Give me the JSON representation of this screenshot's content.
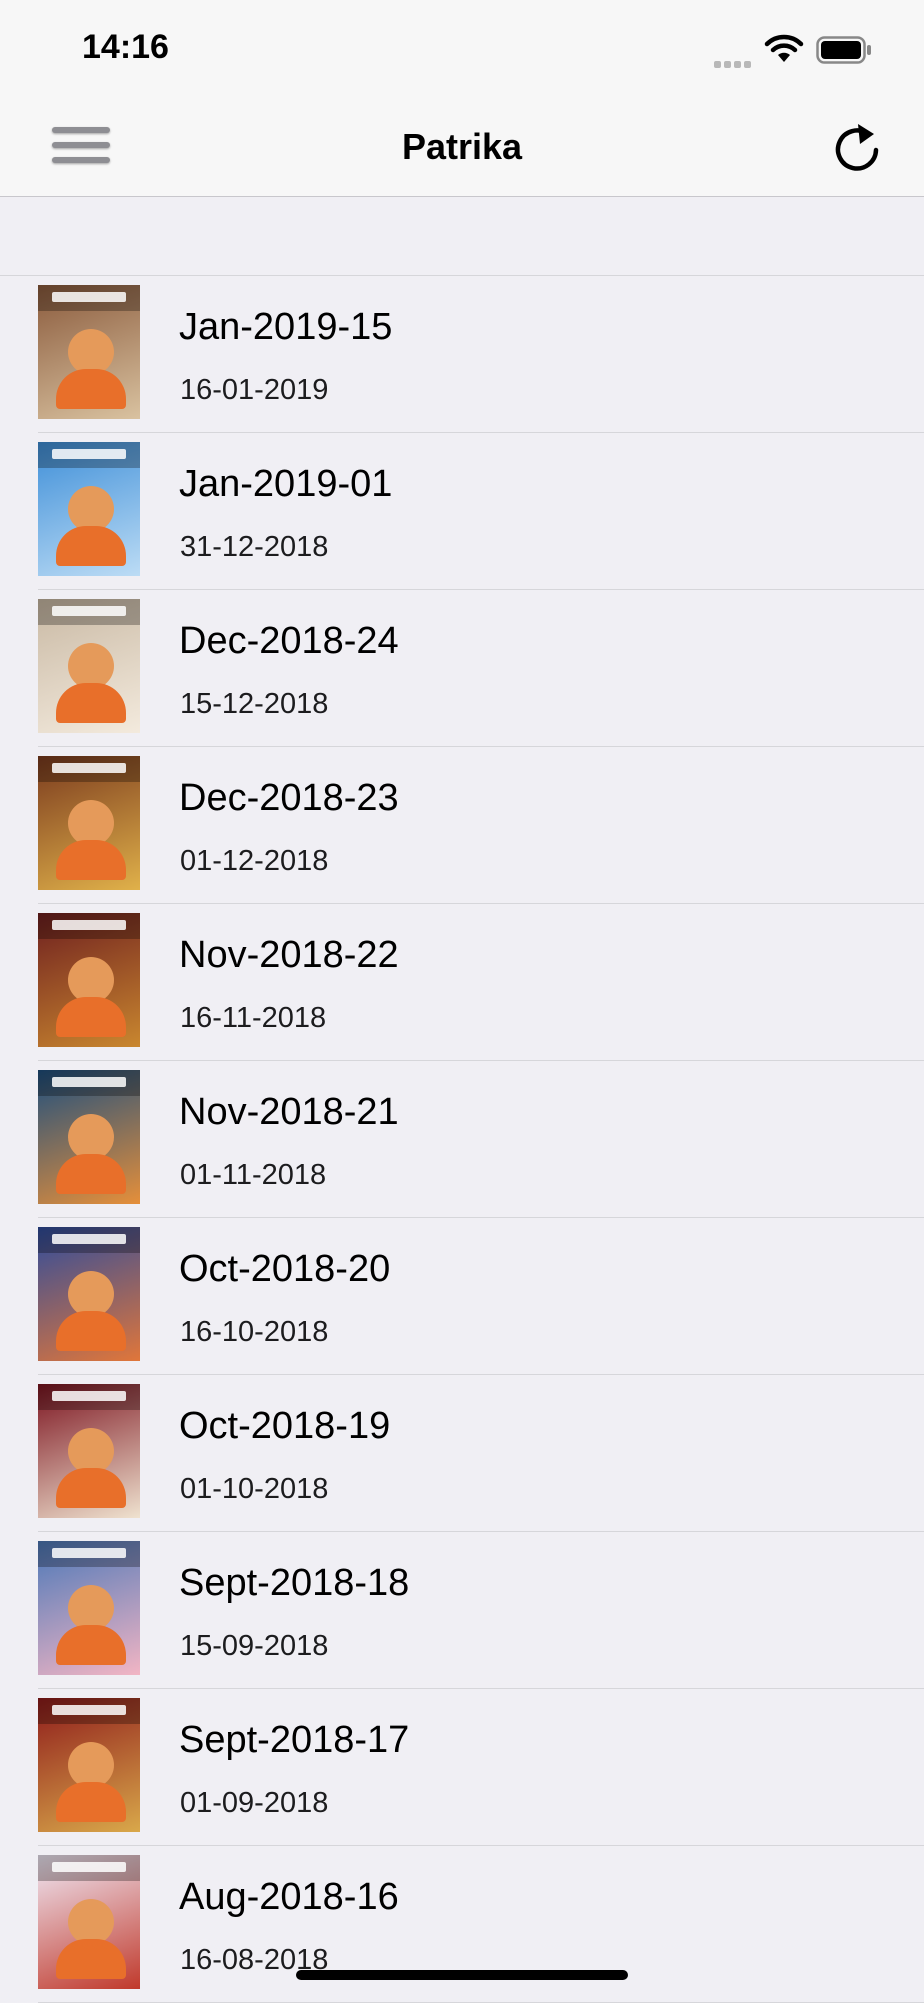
{
  "status_bar": {
    "time": "14:16"
  },
  "nav": {
    "title": "Patrika",
    "menu_icon": "hamburger-menu-icon",
    "refresh_icon": "refresh-icon"
  },
  "items": [
    {
      "title": "Jan-2019-15",
      "date": "16-01-2019",
      "color": "#8a5a3c",
      "accent": "#d9c2a0"
    },
    {
      "title": "Jan-2019-01",
      "date": "31-12-2018",
      "color": "#3f8fd8",
      "accent": "#bcdcf5"
    },
    {
      "title": "Dec-2018-24",
      "date": "15-12-2018",
      "color": "#c9b9a4",
      "accent": "#f3eadd"
    },
    {
      "title": "Dec-2018-23",
      "date": "01-12-2018",
      "color": "#7a3a1e",
      "accent": "#e0b14a"
    },
    {
      "title": "Nov-2018-22",
      "date": "16-11-2018",
      "color": "#6e1f1f",
      "accent": "#c9872f"
    },
    {
      "title": "Nov-2018-21",
      "date": "01-11-2018",
      "color": "#1e4f7e",
      "accent": "#e58f3a"
    },
    {
      "title": "Oct-2018-20",
      "date": "16-10-2018",
      "color": "#2e4c9c",
      "accent": "#e0763a"
    },
    {
      "title": "Oct-2018-19",
      "date": "01-10-2018",
      "color": "#7c1420",
      "accent": "#efe2cf"
    },
    {
      "title": "Sept-2018-18",
      "date": "15-09-2018",
      "color": "#4c78b8",
      "accent": "#f2b5c4"
    },
    {
      "title": "Sept-2018-17",
      "date": "01-09-2018",
      "color": "#8e1b1b",
      "accent": "#d9a84a"
    },
    {
      "title": "Aug-2018-16",
      "date": "16-08-2018",
      "color": "#f0eaf7",
      "accent": "#c0392b"
    }
  ]
}
